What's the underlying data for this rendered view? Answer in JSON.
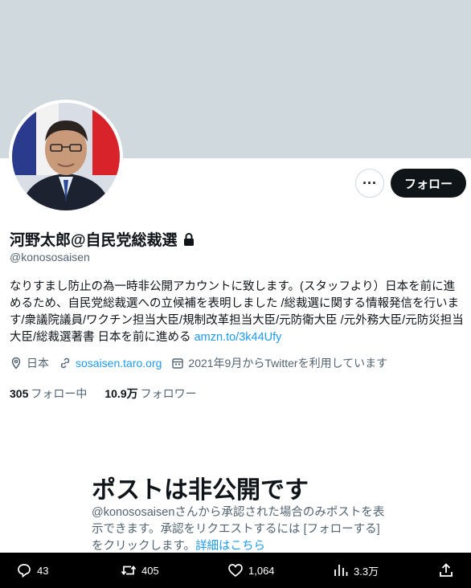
{
  "profile": {
    "display_name": "河野太郎@自民党総裁選",
    "handle": "@konososaisen",
    "bio_text": "なりすまし防止の為一時非公開アカウントに致します。(スタッフより）日本を前に進めるため、自民党総裁選への立候補を表明しました /総裁選に関する情報発信を行います/衆議院議員/ワクチン担当大臣/規制改革担当大臣/元防衛大臣 /元外務大臣/元防災担当大臣/総裁選著書 日本を前に進める ",
    "bio_link": "amzn.to/3k44Ufy",
    "location": "日本",
    "website": "sosaisen.taro.org",
    "joined": "2021年9月からTwitterを利用しています",
    "following_count": "305",
    "following_label": "フォロー中",
    "followers_count": "10.9万",
    "followers_label": "フォロワー"
  },
  "buttons": {
    "more_label": "···",
    "follow_label": "フォロー"
  },
  "private_notice": {
    "title": "ポストは非公開です",
    "description": "@konososaisenさんから承認された場合のみポストを表示できます。承認をリクエストするには [フォローする] をクリックします。",
    "link": "詳細はこちら"
  },
  "action_bar": {
    "replies": "43",
    "reposts": "405",
    "likes": "1,064",
    "views": "3.3万"
  },
  "colors": {
    "banner": "#cfd9de",
    "accent": "#1d9bf0",
    "text": "#0f1419",
    "secondary_text": "#536471"
  },
  "icons": [
    "lock-icon",
    "location-icon",
    "link-icon",
    "calendar-icon",
    "reply-icon",
    "repost-icon",
    "like-icon",
    "views-icon",
    "share-icon"
  ]
}
